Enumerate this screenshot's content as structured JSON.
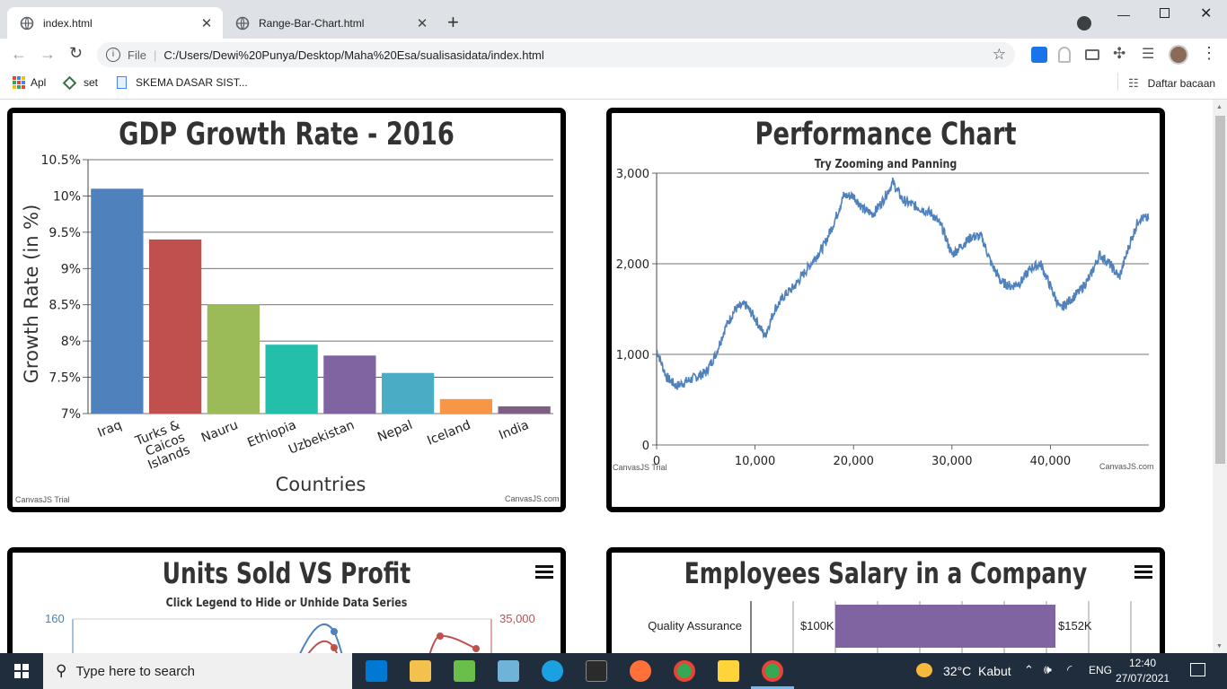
{
  "browser": {
    "tabs": [
      {
        "title": "index.html",
        "active": true
      },
      {
        "title": "Range-Bar-Chart.html",
        "active": false
      }
    ],
    "omnibox": {
      "scheme": "File",
      "url": "C:/Users/Dewi%20Punya/Desktop/Maha%20Esa/sualisasidata/index.html"
    },
    "bookmarks": [
      "Apl",
      "set",
      "SKEMA DASAR SIST..."
    ],
    "reading_list": "Daftar bacaan"
  },
  "charts": {
    "gdp": {
      "title": "GDP Growth Rate - 2016",
      "credit_left": "CanvasJS Trial",
      "credit_right": "CanvasJS.com"
    },
    "perf": {
      "title": "Performance Chart",
      "subtitle": "Try Zooming and Panning",
      "credit_left": "CanvasJS Trial",
      "credit_right": "CanvasJS.com"
    },
    "units": {
      "title": "Units Sold VS Profit",
      "subtitle": "Click Legend to Hide or Unhide Data Series",
      "left_tick": "160",
      "right_tick": "35,000"
    },
    "salary": {
      "title": "Employees Salary in a Company",
      "row_label": "Quality Assurance",
      "low_label": "$100K",
      "high_label": "$152K"
    }
  },
  "chart_data": [
    {
      "type": "bar",
      "title": "GDP Growth Rate - 2016",
      "xlabel": "Countries",
      "ylabel": "Growth Rate (in %)",
      "ylim": [
        7,
        10.5
      ],
      "yticks": [
        "7%",
        "7.5%",
        "8%",
        "8.5%",
        "9%",
        "9.5%",
        "10%",
        "10.5%"
      ],
      "categories": [
        "Iraq",
        "Turks & Caicos Islands",
        "Nauru",
        "Ethiopia",
        "Uzbekistan",
        "Nepal",
        "Iceland",
        "India"
      ],
      "values": [
        10.1,
        9.4,
        8.5,
        7.95,
        7.8,
        7.56,
        7.2,
        7.1
      ],
      "colors": [
        "#4f81bc",
        "#c0504e",
        "#9bbb58",
        "#23bfaa",
        "#8064a1",
        "#4aacc5",
        "#f79647",
        "#7f6084"
      ],
      "grid": true
    },
    {
      "type": "line",
      "title": "Performance Chart",
      "subtitle": "Try Zooming and Panning",
      "xlim": [
        0,
        50000
      ],
      "ylim": [
        0,
        3000
      ],
      "xticks": [
        "0",
        "10,000",
        "20,000",
        "30,000",
        "40,000"
      ],
      "yticks": [
        "0",
        "1,000",
        "2,000",
        "3,000"
      ],
      "x": [
        0,
        1000,
        2000,
        3000,
        4000,
        5000,
        6000,
        7000,
        8000,
        9000,
        10000,
        11000,
        12000,
        13000,
        14000,
        15000,
        16000,
        17000,
        18000,
        19000,
        20000,
        21000,
        22000,
        23000,
        24000,
        25000,
        26000,
        27000,
        28000,
        29000,
        30000,
        31000,
        32000,
        33000,
        34000,
        35000,
        36000,
        37000,
        38000,
        39000,
        40000,
        41000,
        42000,
        43000,
        44000,
        45000,
        46000,
        47000,
        48000,
        49000,
        50000
      ],
      "y": [
        1050,
        750,
        650,
        700,
        750,
        800,
        1000,
        1300,
        1500,
        1550,
        1400,
        1200,
        1500,
        1650,
        1750,
        1900,
        2050,
        2200,
        2450,
        2750,
        2750,
        2600,
        2550,
        2700,
        2900,
        2700,
        2650,
        2600,
        2550,
        2400,
        2100,
        2200,
        2300,
        2300,
        2000,
        1800,
        1750,
        1800,
        1950,
        2000,
        1750,
        1500,
        1600,
        1700,
        1850,
        2100,
        2000,
        1850,
        2200,
        2500,
        2500
      ],
      "color": "#4f81bc",
      "grid": true
    },
    {
      "type": "line",
      "title": "Units Sold VS Profit",
      "subtitle": "Click Legend to Hide or Unhide Data Series"
    },
    {
      "type": "bar",
      "title": "Employees Salary in a Company",
      "categories": [
        "Quality Assurance"
      ],
      "series": [
        {
          "low": 100,
          "high": 152
        }
      ]
    }
  ],
  "taskbar": {
    "search_placeholder": "Type here to search",
    "weather": "32°C  Kabut",
    "lang": "ENG",
    "time": "12:40",
    "date": "27/07/2021"
  }
}
